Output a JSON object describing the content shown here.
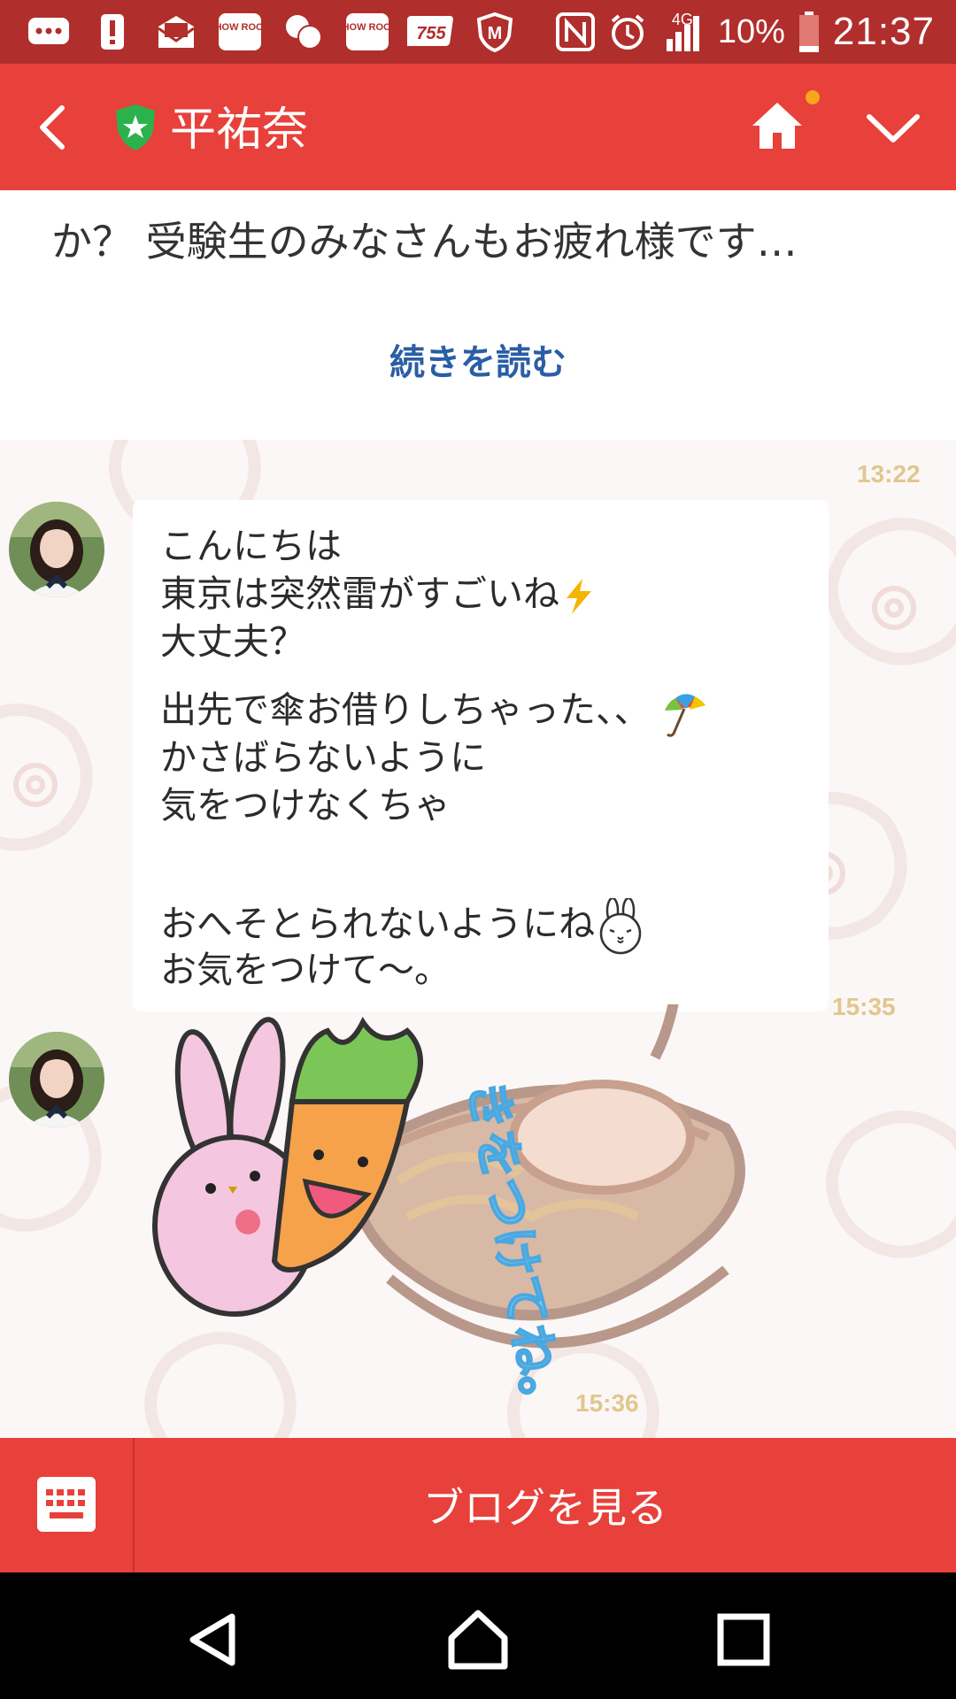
{
  "status_bar": {
    "network": "4G",
    "battery": "10%",
    "clock": "21:37",
    "notification_icons": [
      "message-icon",
      "alert-icon",
      "mail-icon",
      "showroom-icon",
      "chat-icon",
      "showroom-icon",
      "755-icon",
      "shield-icon"
    ],
    "showroom_label": "SHOW ROOM",
    "app_755_label": "755"
  },
  "header": {
    "title": "平祐奈",
    "badge_color": "#2bb24c",
    "accent": "#e8403a"
  },
  "feed": {
    "preview_text": "か？ 受験生のみなさんもお疲れ様です…",
    "read_more": "続きを読む",
    "messages": [
      {
        "time": "13:22",
        "lines": [
          "こんにちは",
          "東京は突然雷がすごいね",
          "大丈夫？",
          "出先で傘お借りしちゃった、、",
          "かさばらないように",
          "気をつけなくちゃ",
          "おへそとられないようにね",
          "お気をつけて〜。"
        ]
      },
      {
        "time": "15:35",
        "sticker": "rabbit-carrot-ramen-sticker",
        "sticker_text": "きをつけてね。"
      }
    ],
    "last_time": "15:36"
  },
  "bottom_bar": {
    "blog_button": "ブログを見る",
    "keyboard_icon": "keyboard-icon"
  },
  "nav": {
    "buttons": [
      "back-nav-icon",
      "home-nav-icon",
      "recents-nav-icon"
    ]
  }
}
